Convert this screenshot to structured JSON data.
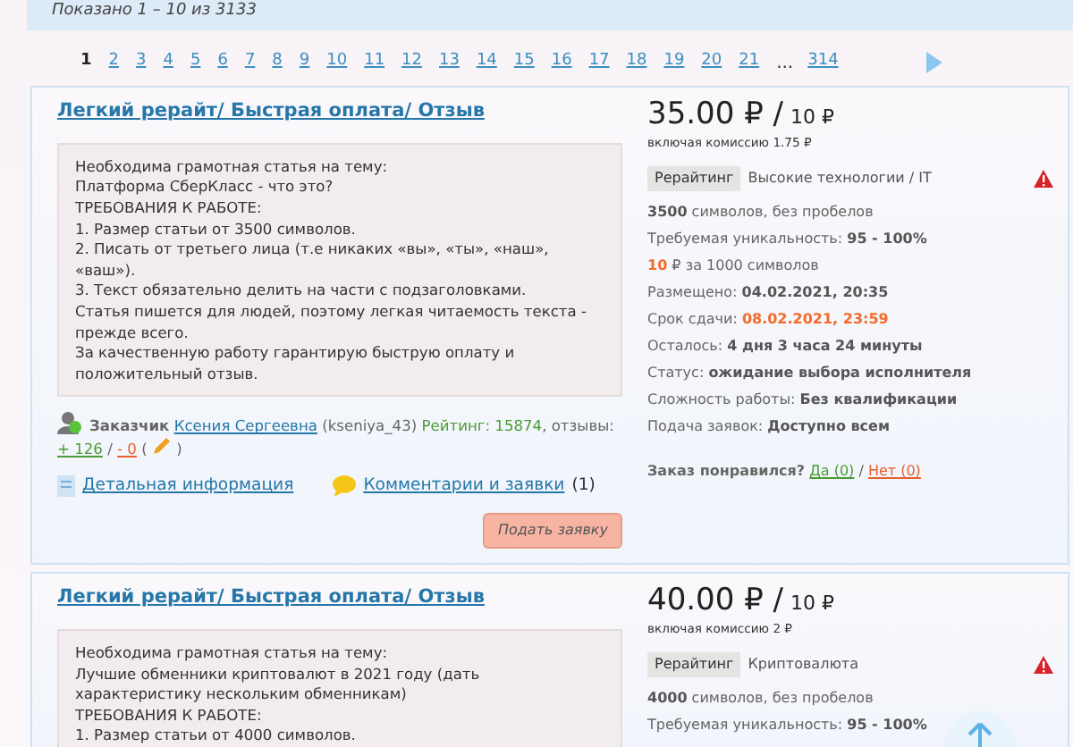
{
  "summary": "Показано 1 – 10 из 3133",
  "pagination": [
    {
      "kind": "page",
      "label": "1",
      "selected": true
    },
    {
      "kind": "page",
      "label": "2",
      "selected": false
    },
    {
      "kind": "page",
      "label": "3",
      "selected": false
    },
    {
      "kind": "page",
      "label": "4",
      "selected": false
    },
    {
      "kind": "page",
      "label": "5",
      "selected": false
    },
    {
      "kind": "page",
      "label": "6",
      "selected": false
    },
    {
      "kind": "page",
      "label": "7",
      "selected": false
    },
    {
      "kind": "page",
      "label": "8",
      "selected": false
    },
    {
      "kind": "page",
      "label": "9",
      "selected": false
    },
    {
      "kind": "page",
      "label": "10",
      "selected": false
    },
    {
      "kind": "page",
      "label": "11",
      "selected": false
    },
    {
      "kind": "page",
      "label": "12",
      "selected": false
    },
    {
      "kind": "page",
      "label": "13",
      "selected": false
    },
    {
      "kind": "page",
      "label": "14",
      "selected": false
    },
    {
      "kind": "page",
      "label": "15",
      "selected": false
    },
    {
      "kind": "page",
      "label": "16",
      "selected": false
    },
    {
      "kind": "page",
      "label": "17",
      "selected": false
    },
    {
      "kind": "page",
      "label": "18",
      "selected": false
    },
    {
      "kind": "page",
      "label": "19",
      "selected": false
    },
    {
      "kind": "page",
      "label": "20",
      "selected": false
    },
    {
      "kind": "page",
      "label": "21",
      "selected": false
    },
    {
      "kind": "gap",
      "label": "..."
    },
    {
      "kind": "page",
      "label": "314",
      "selected": false
    },
    {
      "kind": "next"
    }
  ],
  "orders": [
    {
      "title": "Легкий рерайт/ Быстрая оплата/ Отзыв",
      "price": "35.00 ₽ /",
      "price_unit": "10 ₽",
      "commission": "включая комиссию 1.75 ₽",
      "category_tag": "Рерайтинг",
      "category": "Высокие технологии / IT",
      "description": [
        "Необходима грамотная статья на тему:",
        "Платформа СберКласс - что это?",
        "ТРЕБОВАНИЯ К РАБОТЕ:",
        "1. Размер статьи от 3500 символов.",
        "2. Писать от третьего лица (т.е никаких «вы», «ты», «наш», «ваш»).",
        "3. Текст обязательно делить на части с подзаголовками.",
        "Статья пишется для людей, поэтому легкая читаемость текста - прежде всего.",
        "За качественную работу гарантирую быструю оплату и положительный отзыв."
      ],
      "details": [
        {
          "kind": "lead",
          "value": "3500",
          "text": "символов, без пробелов"
        },
        {
          "kind": "field",
          "label": "Требуемая уникальность:",
          "value": "95 - 100%"
        },
        {
          "kind": "lead_accent",
          "value": "10",
          "text": "₽ за 1000 символов"
        },
        {
          "kind": "field",
          "label": "Размещено:",
          "value": "04.02.2021, 20:35"
        },
        {
          "kind": "field_accent",
          "label": "Срок сдачи:",
          "value": "08.02.2021, 23:59"
        },
        {
          "kind": "field",
          "label": "Осталось:",
          "value": "4 дня 3 часа 24 минуты"
        },
        {
          "kind": "field",
          "label": "Статус:",
          "value": "ожидание выбора исполнителя"
        },
        {
          "kind": "field",
          "label": "Сложность работы:",
          "value": "Без квалификации"
        },
        {
          "kind": "field",
          "label": "Подача заявок:",
          "value": "Доступно всем"
        }
      ],
      "customer": {
        "role": "Заказчик",
        "name": "Ксения Сергеевна",
        "login": "(kseniya_43)",
        "rating": "Рейтинг: 15874",
        "reviews_label": ", отзывы:",
        "positive": "+ 126",
        "separator": "/",
        "negative": "- 0",
        "open_paren": "(",
        "close_paren": ")"
      },
      "links": {
        "details": "Детальная информация",
        "comments": "Комментарии и заявки",
        "comments_count": "(1)"
      },
      "apply_button": "Подать заявку",
      "feedback": {
        "question": "Заказ понравился?",
        "yes": "Да (0)",
        "separator": "/",
        "no": "Нет (0)"
      }
    },
    {
      "title": "Легкий рерайт/ Быстрая оплата/ Отзыв",
      "price": "40.00 ₽ /",
      "price_unit": "10 ₽",
      "commission": "включая комиссию 2 ₽",
      "category_tag": "Рерайтинг",
      "category": "Криптовалюта",
      "description": [
        "Необходима грамотная статья на тему:",
        "Лучшие обменники криптовалют в 2021 году (дать характеристику нескольким обменникам)",
        "ТРЕБОВАНИЯ К РАБОТЕ:",
        "1. Размер статьи от 4000 символов."
      ],
      "details": [
        {
          "kind": "lead",
          "value": "4000",
          "text": "символов, без пробелов"
        },
        {
          "kind": "field",
          "label": "Требуемая уникальность:",
          "value": "95 - 100%"
        }
      ]
    }
  ]
}
